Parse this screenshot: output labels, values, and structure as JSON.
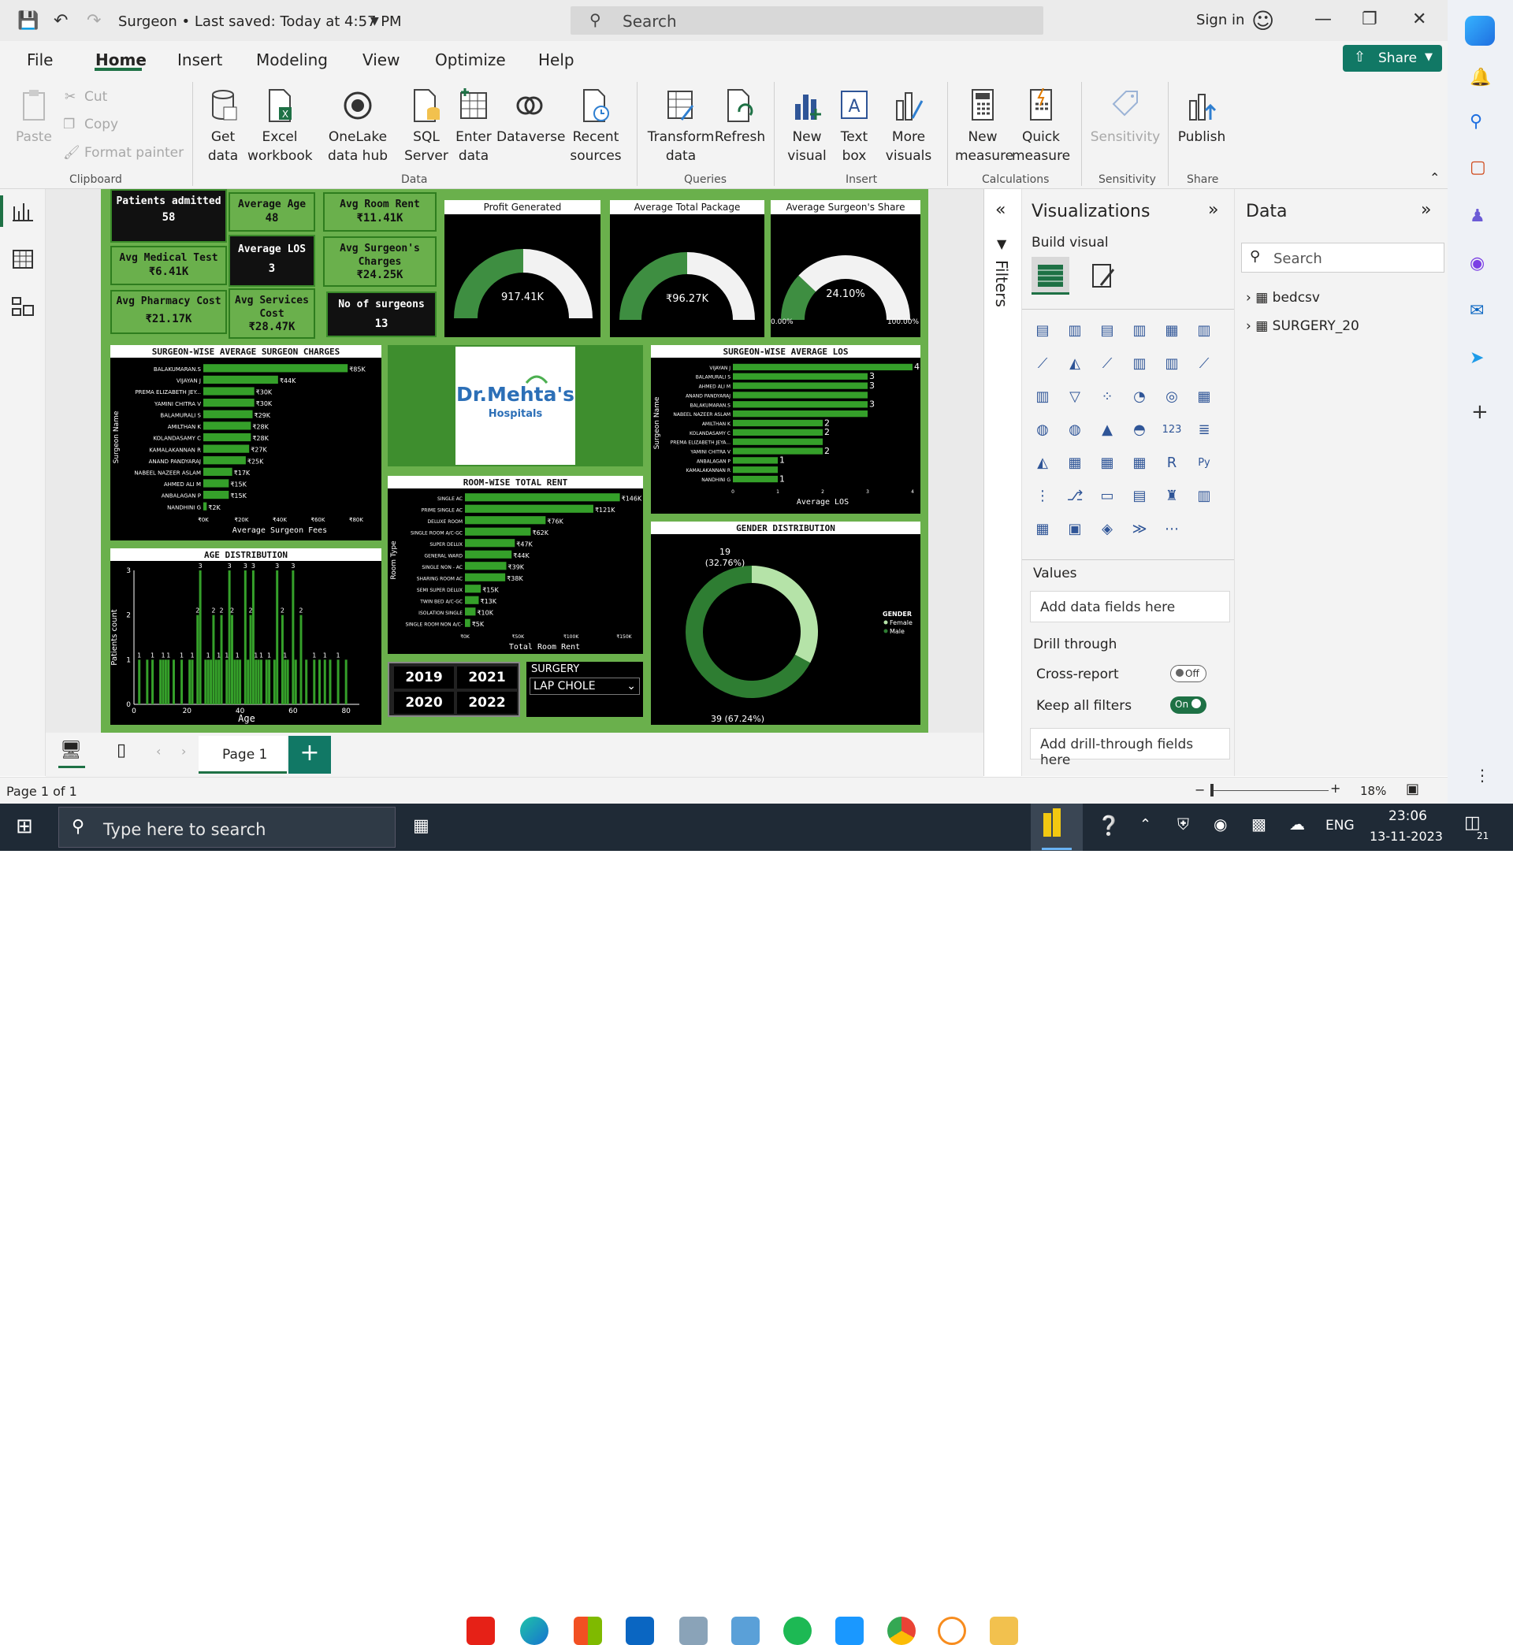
{
  "titlebar": {
    "doc_title": "Surgeon • Last saved: Today at 4:57 PM",
    "search_placeholder": "Search",
    "signin": "Sign in"
  },
  "menu": {
    "items": [
      "File",
      "Home",
      "Insert",
      "Modeling",
      "View",
      "Optimize",
      "Help"
    ],
    "active": "Home",
    "share": "Share"
  },
  "ribbon": {
    "clipboard": {
      "paste": "Paste",
      "cut": "Cut",
      "copy": "Copy",
      "format_painter": "Format painter",
      "group": "Clipboard"
    },
    "data": {
      "get_data": "Get data",
      "excel": "Excel workbook",
      "onelake": "OneLake data hub",
      "sql": "SQL Server",
      "enter": "Enter data",
      "dataverse": "Dataverse",
      "recent": "Recent sources",
      "group": "Data"
    },
    "queries": {
      "transform": "Transform data",
      "refresh": "Refresh",
      "group": "Queries"
    },
    "insert": {
      "new_visual": "New visual",
      "text_box": "Text box",
      "more_visuals": "More visuals",
      "group": "Insert"
    },
    "calculations": {
      "new_measure": "New measure",
      "quick_measure": "Quick measure",
      "group": "Calculations"
    },
    "sensitivity": {
      "label": "Sensitivity",
      "group": "Sensitivity"
    },
    "share": {
      "publish": "Publish",
      "group": "Share"
    }
  },
  "kpis": {
    "patients": {
      "label": "Patients admitted",
      "value": "58"
    },
    "avg_age": {
      "label": "Average Age",
      "value": "48"
    },
    "avg_room_rent": {
      "label": "Avg Room Rent",
      "value": "₹11.41K"
    },
    "avg_medical_test": {
      "label": "Avg Medical Test",
      "value": "₹6.41K"
    },
    "avg_los": {
      "label": "Average LOS",
      "value": "3"
    },
    "avg_surgeon_charges": {
      "label": "Avg Surgeon's Charges",
      "value": "₹24.25K"
    },
    "avg_pharmacy": {
      "label": "Avg Pharmacy Cost",
      "value": "₹21.17K"
    },
    "avg_services": {
      "label": "Avg Services Cost",
      "value": "₹28.47K"
    },
    "no_surgeons": {
      "label": "No of surgeons",
      "value": "13"
    }
  },
  "gauges": {
    "profit": {
      "title": "Profit Generated",
      "value": "917.41K",
      "fraction": 0.5
    },
    "total_package": {
      "title": "Average Total Package",
      "value": "₹96.27K",
      "fraction": 0.5
    },
    "surgeon_share": {
      "title": "Average Surgeon's Share",
      "value": "24.10%",
      "fraction": 0.241,
      "min": "0.00%",
      "max": "100.00%"
    }
  },
  "logo": {
    "line1": "Dr.Mehta's",
    "line2": "Hospitals"
  },
  "slicers": {
    "years": [
      "2019",
      "2021",
      "2020",
      "2022"
    ],
    "surgery_label": "SURGERY",
    "surgery_value": "LAP CHOLE"
  },
  "chart_data": [
    {
      "type": "bar",
      "title": "SURGEON-WISE AVERAGE SURGEON CHARGES",
      "ylabel": "Surgeon Name",
      "xlabel": "Average Surgeon Fees",
      "categories": [
        "BALAKUMARAN.S",
        "VIJAYAN J",
        "PREMA ELIZABETH JEY...",
        "YAMINI CHITRA V",
        "BALAMURALI S",
        "AMILTHAN K",
        "KOLANDASAMY C",
        "KAMALAKANNAN R",
        "ANAND PANDYARAJ",
        "NABEEL NAZEER ASLAM",
        "AHMED ALI M",
        "ANBALAGAN P",
        "NANDHINI G"
      ],
      "values": [
        85,
        44,
        30,
        30,
        29,
        28,
        28,
        27,
        25,
        17,
        15,
        15,
        2
      ],
      "labels": [
        "₹85K",
        "₹44K",
        "₹30K",
        "₹30K",
        "₹29K",
        "₹28K",
        "₹28K",
        "₹27K",
        "₹25K",
        "₹17K",
        "₹15K",
        "₹15K",
        "₹2K"
      ],
      "xticks": [
        "₹0K",
        "₹20K",
        "₹40K",
        "₹60K",
        "₹80K"
      ],
      "xlim": [
        0,
        90
      ]
    },
    {
      "type": "bar",
      "title": "SURGEON-WISE AVERAGE LOS",
      "ylabel": "Surgeon Name",
      "xlabel": "Average LOS",
      "categories": [
        "VIJAYAN J",
        "BALAMURALI S",
        "AHMED ALI M",
        "ANAND PANDYARAJ",
        "BALAKUMARAN.S",
        "NABEEL NAZEER ASLAM",
        "AMILTHAN K",
        "KOLANDASAMY C",
        "PREMA ELIZABETH JEYA...",
        "YAMINI CHITRA V",
        "ANBALAGAN P",
        "KAMALAKANNAN R",
        "NANDHINI G"
      ],
      "values": [
        4,
        3,
        3,
        3,
        3,
        3,
        2,
        2,
        2,
        2,
        1,
        1,
        1
      ],
      "labels": [
        "4",
        "3",
        "3",
        "",
        "3",
        "",
        "2",
        "2",
        "",
        "2",
        "1",
        "",
        "1"
      ],
      "xticks": [
        "0",
        "1",
        "2",
        "3",
        "4"
      ],
      "xlim": [
        0,
        4
      ]
    },
    {
      "type": "bar",
      "title": "ROOM-WISE TOTAL RENT",
      "ylabel": "Room Type",
      "xlabel": "Total Room Rent",
      "categories": [
        "SINGLE AC",
        "PRIME SINGLE AC",
        "DELUXE ROOM",
        "SINGLE ROOM A/C-GC",
        "SUPER DELUX",
        "GENERAL WARD",
        "SINGLE NON - AC",
        "SHARING ROOM AC",
        "SEMI SUPER DELUX",
        "TWIN BED A/C-GC",
        "ISOLATION SINGLE",
        "SINGLE ROOM NON A/C-"
      ],
      "values": [
        146,
        121,
        76,
        62,
        47,
        44,
        39,
        38,
        15,
        13,
        10,
        5
      ],
      "labels": [
        "₹146K",
        "₹121K",
        "₹76K",
        "₹62K",
        "₹47K",
        "₹44K",
        "₹39K",
        "₹38K",
        "₹15K",
        "₹13K",
        "₹10K",
        "₹5K"
      ],
      "xticks": [
        "₹0K",
        "₹50K",
        "₹100K",
        "₹150K"
      ],
      "xlim": [
        0,
        150
      ]
    },
    {
      "type": "bar",
      "title": "AGE DISTRIBUTION",
      "xlabel": "Age",
      "ylabel": "Patients count",
      "x": [
        2,
        5,
        7,
        10,
        11,
        12,
        13,
        15,
        18,
        21,
        22,
        24,
        25,
        27,
        28,
        29,
        30,
        31,
        32,
        33,
        35,
        36,
        37,
        38,
        39,
        40,
        42,
        43,
        44,
        45,
        46,
        47,
        48,
        50,
        51,
        53,
        54,
        56,
        57,
        58,
        60,
        61,
        63,
        65,
        68,
        70,
        72,
        74,
        77,
        80
      ],
      "values": [
        1,
        1,
        1,
        1,
        1,
        1,
        1,
        1,
        1,
        1,
        1,
        2,
        3,
        1,
        1,
        1,
        2,
        1,
        1,
        2,
        1,
        3,
        2,
        1,
        1,
        1,
        3,
        1,
        2,
        3,
        1,
        1,
        1,
        1,
        1,
        1,
        3,
        2,
        1,
        1,
        3,
        1,
        2,
        1,
        1,
        1,
        1,
        1,
        1,
        1
      ],
      "xticks": [
        "0",
        "20",
        "40",
        "60",
        "80"
      ],
      "yticks": [
        "0",
        "1",
        "2",
        "3"
      ],
      "ylim": [
        0,
        3
      ]
    },
    {
      "type": "pie",
      "title": "GENDER DISTRIBUTION",
      "legend_title": "GENDER",
      "series": [
        {
          "name": "Female",
          "value": 19,
          "label": "19",
          "pct": "(32.76%)",
          "color": "#b5e3a8"
        },
        {
          "name": "Male",
          "value": 39,
          "label": "39 (67.24%)",
          "color": "#2e7d32"
        }
      ]
    }
  ],
  "filters": {
    "label": "Filters"
  },
  "visualizations": {
    "title": "Visualizations",
    "build": "Build visual",
    "values": "Values",
    "add_fields": "Add data fields here",
    "drill": "Drill through",
    "cross_report": "Cross-report",
    "cross_state": "Off",
    "keep_filters": "Keep all filters",
    "keep_state": "On",
    "add_drill": "Add drill-through fields here"
  },
  "data_pane": {
    "title": "Data",
    "search": "Search",
    "tables": [
      "bedcsv",
      "SURGERY_20"
    ]
  },
  "pages": {
    "tab": "Page 1",
    "status": "Page 1 of 1",
    "zoom": "18%"
  },
  "taskbar": {
    "search": "Type here to search",
    "lang": "ENG",
    "time": "23:06",
    "date": "13-11-2023",
    "notif": "21"
  }
}
